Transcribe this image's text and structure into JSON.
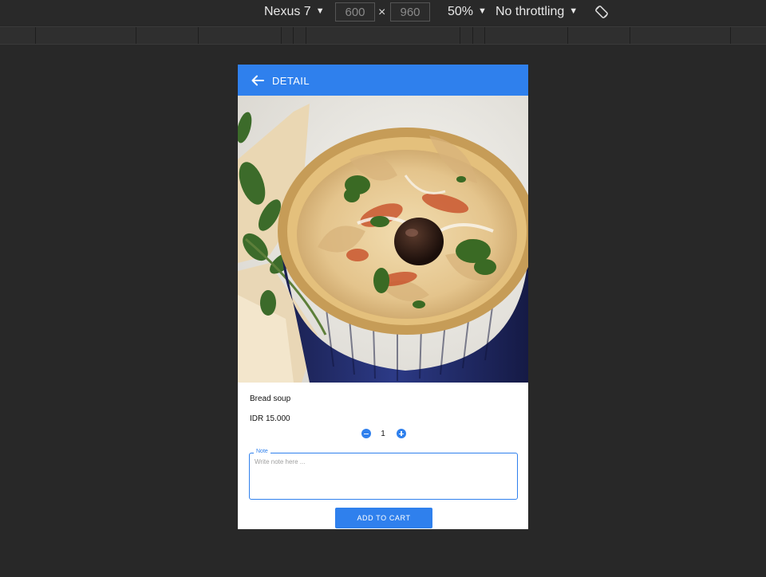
{
  "devtools": {
    "device": "Nexus 7",
    "width": "600",
    "height": "960",
    "times": "×",
    "zoom": "50%",
    "throttling": "No throttling",
    "arrow": "▼",
    "rotate_icon": "rotate-icon"
  },
  "app": {
    "title": "DETAIL",
    "back_icon": "arrow-left-icon",
    "accent": "#2f80ed"
  },
  "product": {
    "image": "bowl of hummus with olive and parsley",
    "name": "Bread soup",
    "price": "IDR 15.000",
    "quantity": "1"
  },
  "note": {
    "legend": "Note",
    "placeholder": "Write note here ...",
    "value": ""
  },
  "actions": {
    "add_to_cart": "ADD TO CART"
  }
}
